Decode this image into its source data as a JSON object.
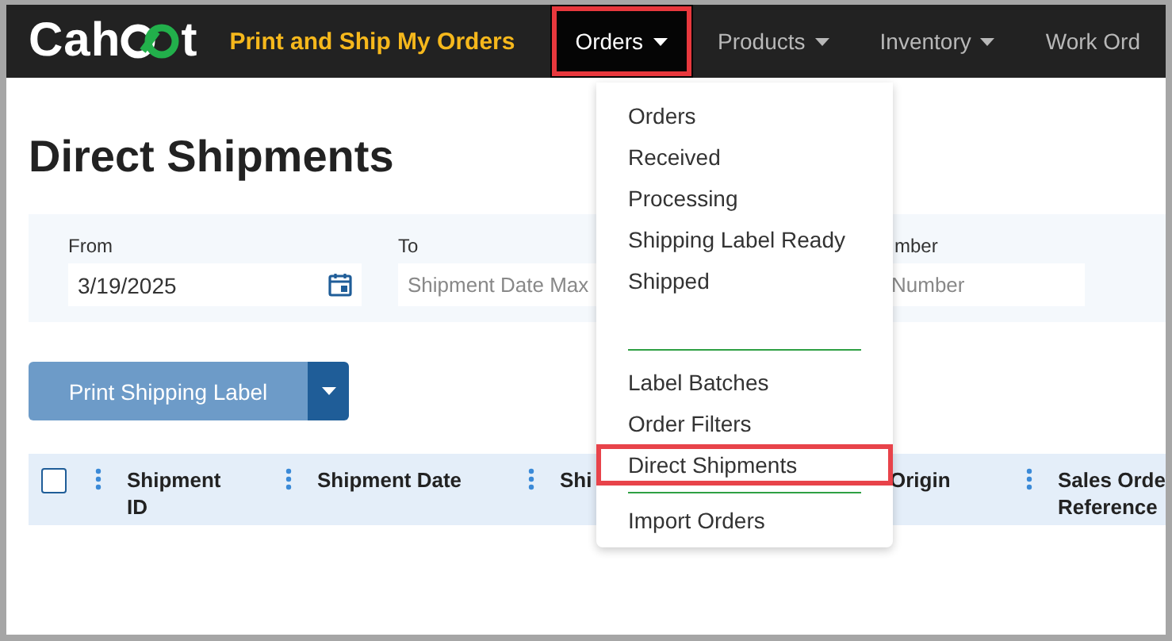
{
  "logo": {
    "text_before": "Cah",
    "text_after": "t"
  },
  "nav": [
    {
      "label": "Print and Ship My Orders",
      "kind": "feature",
      "caret": false,
      "selected": false,
      "highlighted": false
    },
    {
      "label": "Orders",
      "kind": "menu",
      "caret": true,
      "selected": true,
      "highlighted": true
    },
    {
      "label": "Products",
      "kind": "menu",
      "caret": true,
      "selected": false,
      "highlighted": false
    },
    {
      "label": "Inventory",
      "kind": "menu",
      "caret": true,
      "selected": false,
      "highlighted": false
    },
    {
      "label": "Work Ord",
      "kind": "menu",
      "caret": false,
      "selected": false,
      "highlighted": false
    }
  ],
  "menu": [
    {
      "kind": "item",
      "label": "Orders",
      "highlighted": false
    },
    {
      "kind": "item",
      "label": "Received",
      "highlighted": false
    },
    {
      "kind": "item",
      "label": "Processing",
      "highlighted": false
    },
    {
      "kind": "item",
      "label": "Shipping Label Ready",
      "highlighted": false
    },
    {
      "kind": "item",
      "label": "Shipped",
      "highlighted": false
    },
    {
      "kind": "divider"
    },
    {
      "kind": "item",
      "label": "Label Batches",
      "highlighted": false
    },
    {
      "kind": "item",
      "label": "Order Filters",
      "highlighted": false
    },
    {
      "kind": "item",
      "label": "Direct Shipments",
      "highlighted": true
    },
    {
      "kind": "divider"
    },
    {
      "kind": "item",
      "label": "Import Orders",
      "highlighted": false
    }
  ],
  "page_title": "Direct Shipments",
  "filters": [
    {
      "label": "From",
      "value": "3/19/2025",
      "calendar": true
    },
    {
      "label": "To",
      "placeholder": "Shipment Date Max",
      "calendar": false
    },
    {
      "label": "mber",
      "placeholder": "Number",
      "calendar": false
    }
  ],
  "print_button": {
    "label": "Print Shipping Label"
  },
  "table": {
    "select_all_checked": false,
    "columns": [
      {
        "lines": [
          "Shipment",
          "ID"
        ],
        "menu": true
      },
      {
        "lines": [
          "Shipment Date"
        ],
        "menu": true
      },
      {
        "lines": [
          "Shi"
        ],
        "menu": true
      },
      {
        "lines": [
          "Origin"
        ],
        "menu": false
      },
      {
        "lines": [
          "Sales Orde",
          "Reference"
        ],
        "menu": true
      }
    ]
  }
}
